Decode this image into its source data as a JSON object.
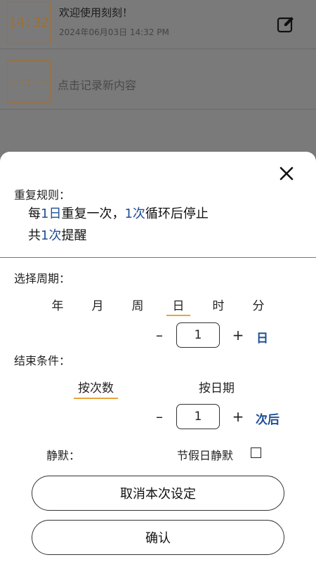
{
  "list": {
    "items": [
      {
        "time": "14:32",
        "title": "欢迎使用刻刻！",
        "subtitle": "2024年06月03日 14:32 PM"
      },
      {
        "time": "--:--",
        "title": "点击记录新内容"
      }
    ]
  },
  "icons": {
    "edit": "edit-icon",
    "close": "close-icon",
    "checkbox": "checkbox-icon"
  },
  "sheet": {
    "rule_label": "重复规则：",
    "summary_line1": {
      "p1": "每",
      "n1": "1日",
      "p2": "重复一次，",
      "n2": "1次",
      "p3": "循环后停止"
    },
    "summary_line2": {
      "p1": "共",
      "n1": "1次",
      "p2": "提醒"
    },
    "period_label": "选择周期：",
    "periods": [
      "年",
      "月",
      "周",
      "日",
      "时",
      "分"
    ],
    "period_selected": "日",
    "period_stepper": {
      "minus": "–",
      "value": "1",
      "plus": "+",
      "unit": "日"
    },
    "end_label": "结束条件：",
    "end_options": [
      "按次数",
      "按日期"
    ],
    "end_selected": "按次数",
    "end_stepper": {
      "minus": "–",
      "value": "1",
      "plus": "+",
      "unit": "次后"
    },
    "silent_label": "静默：",
    "holiday_label": "节假日静默",
    "holiday_checked": false,
    "cancel_label": "取消本次设定",
    "confirm_label": "确认"
  },
  "colors": {
    "accent": "#1f4f95",
    "underline": "#e9a23b",
    "time_box": "#a36e2d",
    "overlay": "#7a7a7a"
  }
}
